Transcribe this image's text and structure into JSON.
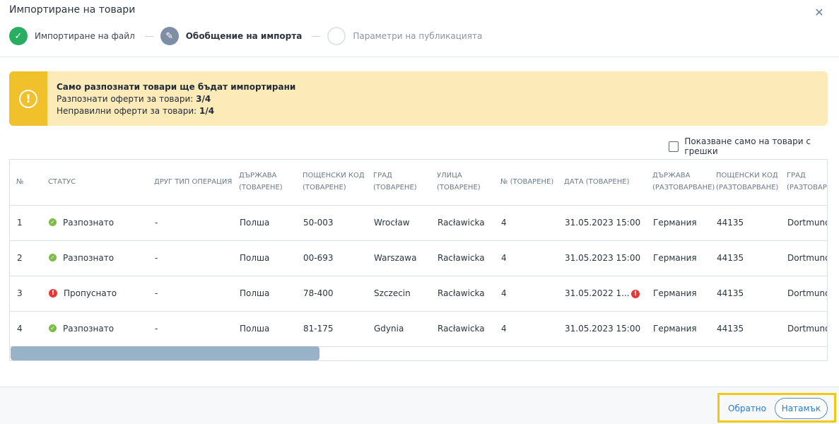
{
  "modal": {
    "title": "Импортиране на товари"
  },
  "steps": [
    {
      "label": "Импортиране на файл",
      "state": "done"
    },
    {
      "label": "Обобщение на импорта",
      "state": "active"
    },
    {
      "label": "Параметри на публикацията",
      "state": "todo"
    }
  ],
  "alert": {
    "heading": "Само разпознати товари ще бъдат импортирани",
    "recognized_label": "Разпознати оферти за товари: ",
    "recognized_value": "3/4",
    "invalid_label": "Неправилни оферти за товари: ",
    "invalid_value": "1/4",
    "icon": "!"
  },
  "filter": {
    "label": "Показване само на товари с грешки"
  },
  "table": {
    "headers": [
      [
        "№"
      ],
      [
        "СТАТУС"
      ],
      [
        "ДРУГ ТИП ОПЕРАЦИЯ"
      ],
      [
        "ДЪРЖАВА",
        "(ТОВАРЕНЕ)"
      ],
      [
        "ПОЩЕНСКИ КОД",
        "(ТОВАРЕНЕ)"
      ],
      [
        "ГРАД",
        "(ТОВАРЕНЕ)"
      ],
      [
        "УЛИЦА",
        "(ТОВАРЕНЕ)"
      ],
      [
        "№ (ТОВАРЕНЕ)"
      ],
      [
        "ДАТА (ТОВАРЕНЕ)"
      ],
      [
        "ДЪРЖАВА",
        "(РАЗТОВАРВАНЕ)"
      ],
      [
        "ПОЩЕНСКИ КОД",
        "(РАЗТОВАРВАНЕ)"
      ],
      [
        "ГРАД",
        "(РАЗТОВАРВА"
      ]
    ],
    "rows": [
      {
        "num": "1",
        "status": "Разпознато",
        "ok": true,
        "op": "-",
        "country": "Полша",
        "zip": "50-003",
        "city": "Wrocław",
        "street": "Racławicka",
        "no": "4",
        "date": "31.05.2023 15:00",
        "date_error": false,
        "u_country": "Германия",
        "u_zip": "44135",
        "u_city": "Dortmund"
      },
      {
        "num": "2",
        "status": "Разпознато",
        "ok": true,
        "op": "-",
        "country": "Полша",
        "zip": "00-693",
        "city": "Warszawa",
        "street": "Racławicka",
        "no": "4",
        "date": "31.05.2023 15:00",
        "date_error": false,
        "u_country": "Германия",
        "u_zip": "44135",
        "u_city": "Dortmund"
      },
      {
        "num": "3",
        "status": "Пропуснато",
        "ok": false,
        "op": "-",
        "country": "Полша",
        "zip": "78-400",
        "city": "Szczecin",
        "street": "Racławicka",
        "no": "4",
        "date": "31.05.2022 1...",
        "date_error": true,
        "u_country": "Германия",
        "u_zip": "44135",
        "u_city": "Dortmund"
      },
      {
        "num": "4",
        "status": "Разпознато",
        "ok": true,
        "op": "-",
        "country": "Полша",
        "zip": "81-175",
        "city": "Gdynia",
        "street": "Racławicka",
        "no": "4",
        "date": "31.05.2023 15:00",
        "date_error": false,
        "u_country": "Германия",
        "u_zip": "44135",
        "u_city": "Dortmund"
      }
    ]
  },
  "footer": {
    "back_label": "Обратно",
    "next_label": "Натамък"
  },
  "colors": {
    "success": "#27ae60",
    "warning": "#f0c12a",
    "error": "#e53935",
    "link": "#2a7ac7"
  }
}
